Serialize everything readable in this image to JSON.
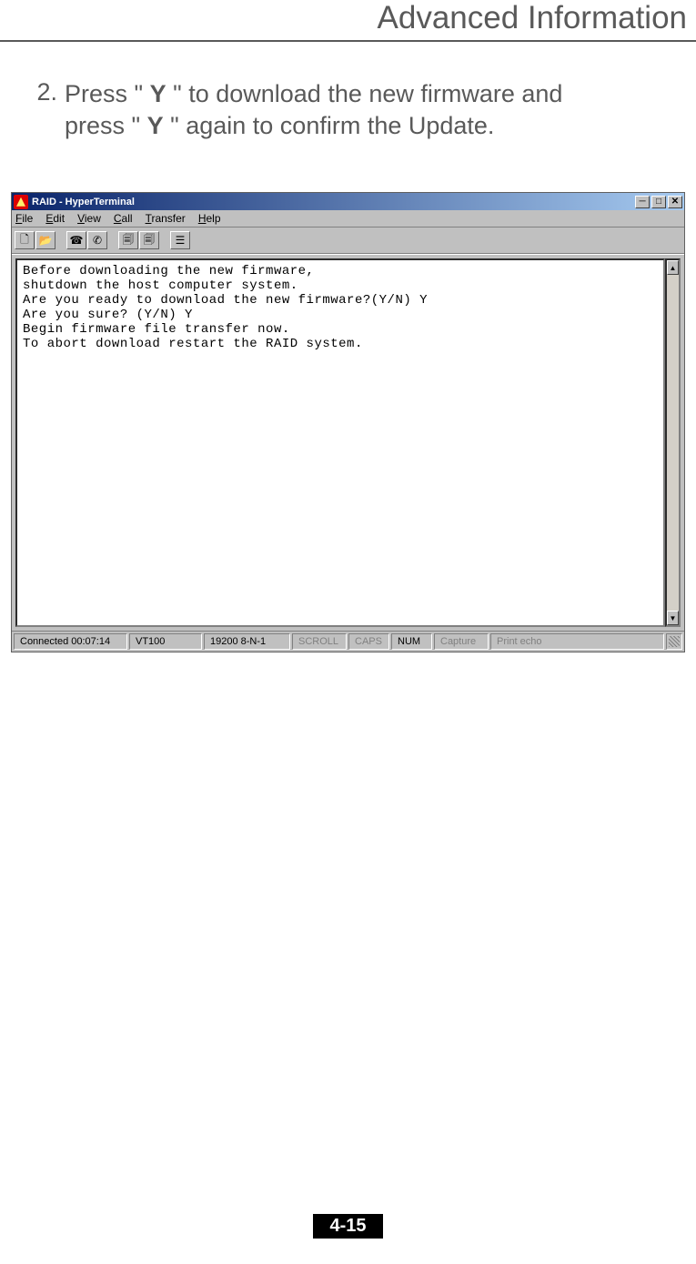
{
  "page": {
    "header_title": "Advanced Information",
    "page_number": "4-15"
  },
  "instruction": {
    "number": "2.",
    "pre1": "Press \" ",
    "key1": "Y",
    "mid1": " \"  to download the new firmware and",
    "line2_pre": "press \" ",
    "key2": "Y",
    "line2_post": " \" again to confirm the Update."
  },
  "window": {
    "title": "RAID - HyperTerminal",
    "menu": {
      "file": "File",
      "edit": "Edit",
      "view": "View",
      "call": "Call",
      "transfer": "Transfer",
      "help": "Help"
    },
    "toolbar_icons": [
      "new-file-icon",
      "open-icon",
      "phone-connect-icon",
      "phone-hangup-icon",
      "send-icon",
      "receive-icon",
      "properties-icon"
    ],
    "terminal_lines": [
      "Before downloading the new firmware,",
      "shutdown the host computer system.",
      "Are you ready to download the new firmware?(Y/N) Y",
      "Are you sure? (Y/N) Y",
      "Begin firmware file transfer now.",
      "To abort download restart the RAID system."
    ],
    "status": {
      "connected": "Connected 00:07:14",
      "terminal": "VT100",
      "serial": "19200 8-N-1",
      "scroll": "SCROLL",
      "caps": "CAPS",
      "num": "NUM",
      "capture": "Capture",
      "printecho": "Print echo"
    }
  }
}
